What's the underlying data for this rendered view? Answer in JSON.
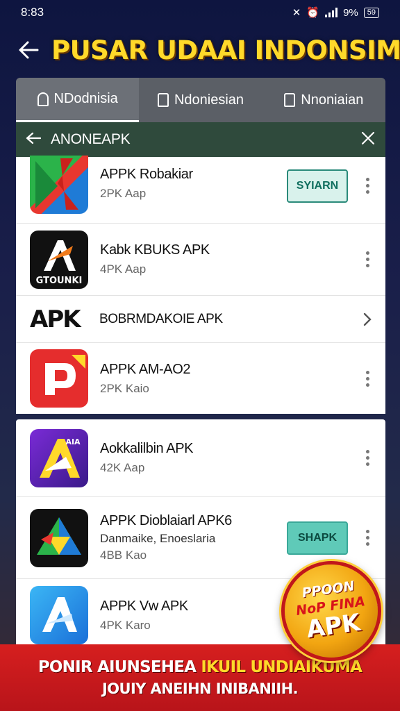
{
  "status_bar": {
    "time": "8:83",
    "battery_pct": "9%",
    "battery_label": "59"
  },
  "header": {
    "title": "PUSAR UDAAI  INDONSIM"
  },
  "tabs": [
    {
      "label": "NDodnisia"
    },
    {
      "label": "Ndoniesian"
    },
    {
      "label": "Nnoniaian"
    }
  ],
  "search": {
    "text": "ANONEAPK"
  },
  "list": [
    {
      "title": "APPK Robakiar",
      "subtitle": "2PK Aap",
      "button": "SYIARN",
      "icon": "red-green-x-app-icon"
    },
    {
      "title": "Kabk KBUKS APK",
      "subtitle": "4PK Aap",
      "icon": "gtounki-a-icon",
      "icon_text": "GTOUNKI"
    },
    {
      "title": "BOBRMDAKOIE APK",
      "logo": "APK",
      "icon": "chevron-right-icon"
    },
    {
      "title": "APPK AM-AO2",
      "subtitle": "2PK Kaio",
      "icon": "red-d-app-icon"
    }
  ],
  "list2": [
    {
      "title": "Aokkalilbin APK",
      "subtitle": "42K Aap",
      "icon": "purple-a-app-icon",
      "icon_text": "AIA"
    },
    {
      "title": "APPK Dioblaiarl APK6",
      "subtitle": "Danmaike, Enoeslaria",
      "subtitle2": "4BB Kao",
      "button": "SHAPK",
      "icon": "green-blue-triangle-app-icon"
    },
    {
      "title": "APPK Vw APK",
      "subtitle": "4PK Karo",
      "icon": "blue-a-app-icon"
    }
  ],
  "badge": {
    "line1": "PPOON",
    "line2": "NoP FINA",
    "line3": "APK"
  },
  "banner": {
    "line1_a": "PONIR AIUNSEHEA",
    "line1_b": "IKUIL UNDIAIKUMA",
    "line2": "JOUIY ANEIHN INIBANIIH."
  },
  "colors": {
    "title_yellow": "#ffd92a",
    "accent_teal": "#2a8a7a",
    "banner_red": "#d61f1f",
    "search_green": "#2f4a3c"
  }
}
